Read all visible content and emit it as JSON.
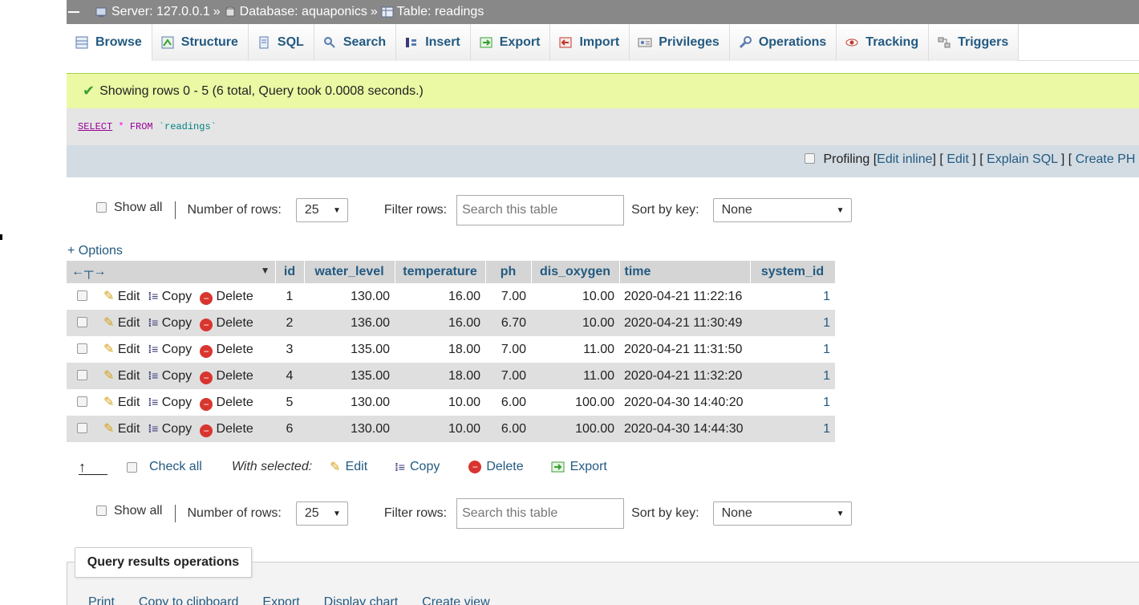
{
  "breadcrumb": {
    "server": "Server: 127.0.0.1",
    "database": "Database: aquaponics",
    "table": "Table: readings",
    "separator": "»"
  },
  "tabs": [
    {
      "label": "Browse",
      "icon": "browse-icon"
    },
    {
      "label": "Structure",
      "icon": "structure-icon"
    },
    {
      "label": "SQL",
      "icon": "sql-icon"
    },
    {
      "label": "Search",
      "icon": "search-icon"
    },
    {
      "label": "Insert",
      "icon": "insert-icon"
    },
    {
      "label": "Export",
      "icon": "export-icon"
    },
    {
      "label": "Import",
      "icon": "import-icon"
    },
    {
      "label": "Privileges",
      "icon": "privileges-icon"
    },
    {
      "label": "Operations",
      "icon": "operations-icon"
    },
    {
      "label": "Tracking",
      "icon": "tracking-icon"
    },
    {
      "label": "Triggers",
      "icon": "triggers-icon"
    }
  ],
  "message": "Showing rows 0 - 5 (6 total, Query took 0.0008 seconds.)",
  "sql": {
    "select": "SELECT",
    "star": "*",
    "from": "FROM",
    "table": "`readings`"
  },
  "profiling": {
    "label": "Profiling",
    "edit_inline": "Edit inline",
    "edit": "Edit",
    "explain": "Explain SQL",
    "create_php": "Create PH"
  },
  "controls": {
    "show_all": "Show all",
    "number_of_rows_label": "Number of rows:",
    "number_of_rows_value": "25",
    "filter_label": "Filter rows:",
    "filter_placeholder": "Search this table",
    "sort_label": "Sort by key:",
    "sort_value": "None"
  },
  "options_link": "+ Options",
  "columns": [
    "id",
    "water_level",
    "temperature",
    "ph",
    "dis_oxygen",
    "time",
    "system_id"
  ],
  "row_actions": {
    "edit": "Edit",
    "copy": "Copy",
    "delete": "Delete"
  },
  "rows": [
    {
      "id": "1",
      "water_level": "130.00",
      "temperature": "16.00",
      "ph": "7.00",
      "dis_oxygen": "10.00",
      "time": "2020-04-21 11:22:16",
      "system_id": "1"
    },
    {
      "id": "2",
      "water_level": "136.00",
      "temperature": "16.00",
      "ph": "6.70",
      "dis_oxygen": "10.00",
      "time": "2020-04-21 11:30:49",
      "system_id": "1"
    },
    {
      "id": "3",
      "water_level": "135.00",
      "temperature": "18.00",
      "ph": "7.00",
      "dis_oxygen": "11.00",
      "time": "2020-04-21 11:31:50",
      "system_id": "1"
    },
    {
      "id": "4",
      "water_level": "135.00",
      "temperature": "18.00",
      "ph": "7.00",
      "dis_oxygen": "11.00",
      "time": "2020-04-21 11:32:20",
      "system_id": "1"
    },
    {
      "id": "5",
      "water_level": "130.00",
      "temperature": "10.00",
      "ph": "6.00",
      "dis_oxygen": "100.00",
      "time": "2020-04-30 14:40:20",
      "system_id": "1"
    },
    {
      "id": "6",
      "water_level": "130.00",
      "temperature": "10.00",
      "ph": "6.00",
      "dis_oxygen": "100.00",
      "time": "2020-04-30 14:44:30",
      "system_id": "1"
    }
  ],
  "bulk": {
    "check_all": "Check all",
    "with_selected": "With selected:",
    "edit": "Edit",
    "copy": "Copy",
    "delete": "Delete",
    "export": "Export"
  },
  "query_ops": {
    "title": "Query results operations",
    "links": [
      "Print",
      "Copy to clipboard",
      "Export",
      "Display chart",
      "Create view"
    ]
  }
}
